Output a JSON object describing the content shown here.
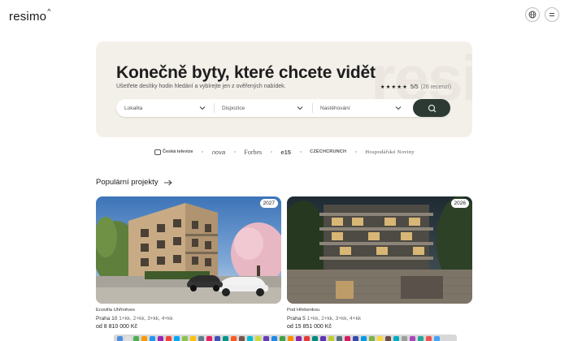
{
  "header": {
    "logo": "resimo",
    "logo_mark": "^",
    "globe_icon": "globe-icon",
    "menu_icon": "hamburger-menu-icon"
  },
  "hero": {
    "title": "Konečně byty, které chcete vidět",
    "subtitle": "Ušetřete desítky hodin hledání a vybírejte jen z ověřených nabídek.",
    "rating": {
      "stars": "★★★★★",
      "score": "5/5",
      "count": "(26 recenzí)"
    },
    "watermark": "resi"
  },
  "search": {
    "locality_placeholder": "Lokalita",
    "layout_placeholder": "Dispozice",
    "sort_placeholder": "Nastěhování",
    "search_icon": "search-icon"
  },
  "press": {
    "items": [
      "Česká televize",
      "nova",
      "Forbes",
      "e15",
      "CZECHCRUNCH",
      "Hospodářské Noviny"
    ]
  },
  "popular": {
    "title": "Populární projekty",
    "arrow_icon": "arrow-right-icon",
    "cards": [
      {
        "year": "2027",
        "name": "Ecovilla Uhříněves",
        "location": "Praha 10",
        "types": "1+kk, 2+kk, 3+kk, 4+kk",
        "price": "od 8 810 000 Kč"
      },
      {
        "year": "2026",
        "name": "Pod Hřebenkou",
        "location": "Praha 5",
        "types": "1+kk, 2+kk, 3+kk, 4+kk",
        "price": "od 15 851 000 Kč"
      }
    ]
  },
  "colors": {
    "hero_bg": "#f3efe9",
    "search_button": "#2c3a33",
    "text": "#1d1d1d"
  }
}
